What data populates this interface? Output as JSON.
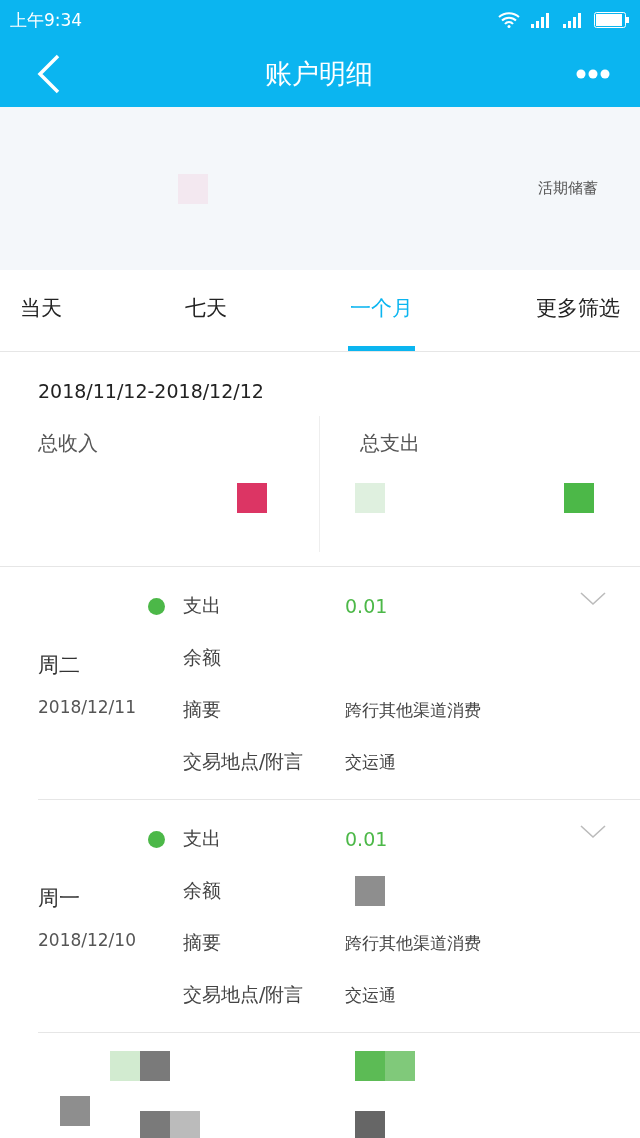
{
  "status_bar": {
    "time": "上午9:34"
  },
  "header": {
    "title": "账户明细"
  },
  "account": {
    "type": "活期储蓄"
  },
  "tabs": [
    {
      "label": "当天",
      "selected": false
    },
    {
      "label": "七天",
      "selected": false
    },
    {
      "label": "一个月",
      "selected": true
    },
    {
      "label": "更多筛选",
      "selected": false
    }
  ],
  "summary": {
    "range": "2018/11/12-2018/12/12",
    "income_label": "总收入",
    "expense_label": "总支出"
  },
  "transactions": [
    {
      "weekday": "周二",
      "date": "2018/12/11",
      "expanded": false,
      "fields": [
        {
          "kind": "amount",
          "label": "支出",
          "value": "0.01"
        },
        {
          "kind": "plain",
          "label": "余额"
        },
        {
          "kind": "plain",
          "label": "摘要",
          "value": "跨行其他渠道消费"
        },
        {
          "kind": "plain",
          "label": "交易地点/附言",
          "value": "交运通"
        }
      ]
    },
    {
      "weekday": "周一",
      "date": "2018/12/10",
      "expanded": false,
      "fields": [
        {
          "kind": "amount",
          "label": "支出",
          "value": "0.01"
        },
        {
          "kind": "hidden",
          "label": "余额"
        },
        {
          "kind": "plain",
          "label": "摘要",
          "value": "跨行其他渠道消费"
        },
        {
          "kind": "plain",
          "label": "交易地点/附言",
          "value": "交运通"
        }
      ]
    }
  ]
}
